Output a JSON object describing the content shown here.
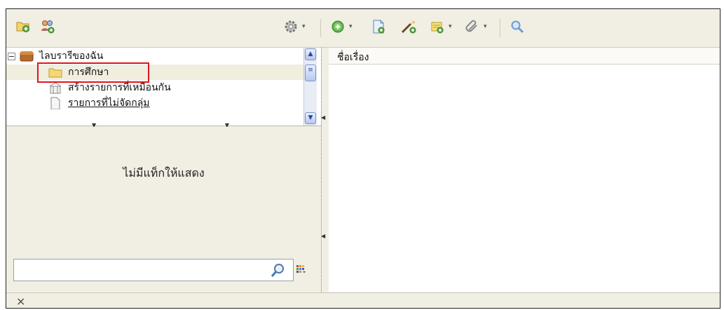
{
  "tree": {
    "root_label": "ไลบรารีของฉัน",
    "items": [
      {
        "label": "การศึกษา"
      },
      {
        "label": "สร้างรายการที่เหมือนกัน"
      },
      {
        "label": "รายการที่ไม่จัดกลุ่ม"
      }
    ]
  },
  "tag_selector": {
    "empty_message": "ไม่มีแท็กให้แสดง",
    "search_value": ""
  },
  "items_pane": {
    "column_title": "ชื่อเรื่อง"
  },
  "status_bar": {
    "close_glyph": "×"
  },
  "toolbar_icons": [
    "new-collection-icon",
    "new-group-icon",
    "actions-gear-icon",
    "new-item-icon",
    "new-item-from-page-icon",
    "add-by-identifier-wand-icon",
    "new-note-icon",
    "attachment-paperclip-icon",
    "advanced-search-icon"
  ],
  "colors": {
    "highlight": "#e0161b",
    "window_bg": "#f1eee3",
    "selected_row": "#f1eddf"
  }
}
